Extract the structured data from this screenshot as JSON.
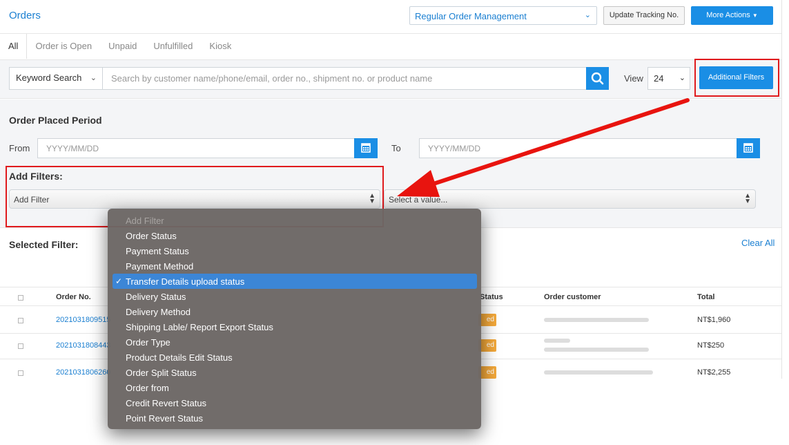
{
  "header": {
    "title": "Orders",
    "management_select": "Regular Order Management",
    "update_tracking_label": "Update Tracking No.",
    "more_actions_label": "More Actions"
  },
  "tabs": [
    {
      "label": "All",
      "active": true
    },
    {
      "label": "Order is Open"
    },
    {
      "label": "Unpaid"
    },
    {
      "label": "Unfulfilled"
    },
    {
      "label": "Kiosk"
    }
  ],
  "search": {
    "keyword_select": "Keyword Search",
    "placeholder": "Search by customer name/phone/email, order no., shipment no. or product name",
    "view_label": "View",
    "view_value": "24",
    "additional_filters_label": "Additional Filters"
  },
  "period": {
    "title": "Order Placed Period",
    "from_label": "From",
    "to_label": "To",
    "date_placeholder": "YYYY/MM/DD"
  },
  "add_filters": {
    "title": "Add Filters:",
    "filter_select": "Add Filter",
    "value_select": "Select a value..."
  },
  "selected_filter": {
    "title": "Selected Filter:",
    "clear_all": "Clear All"
  },
  "table": {
    "headers": {
      "order_no": "Order No.",
      "status": "Status",
      "customer": "Order customer",
      "total": "Total"
    },
    "rows": [
      {
        "order_no": "2021031809515",
        "status": "ed",
        "total": "NT$1,960"
      },
      {
        "order_no": "2021031808443",
        "status": "ed",
        "total": "NT$250"
      },
      {
        "order_no": "2021031806260",
        "status": "ed",
        "total": "NT$2,255"
      }
    ]
  },
  "dropdown": {
    "items": [
      "Add Filter",
      "Order Status",
      "Payment Status",
      "Payment Method",
      "Transfer Details upload status",
      "Delivery Status",
      "Delivery Method",
      "Shipping Lable/ Report Export Status",
      "Order Type",
      "Product Details Edit Status",
      "Order Split Status",
      "Order from",
      "Credit Revert Status",
      "Point Revert Status"
    ],
    "selected_index": 4
  },
  "colors": {
    "accent": "#1a8ee5",
    "link": "#1a7fd1",
    "highlight": "#e0191c",
    "status_badge": "#f3a83a"
  }
}
